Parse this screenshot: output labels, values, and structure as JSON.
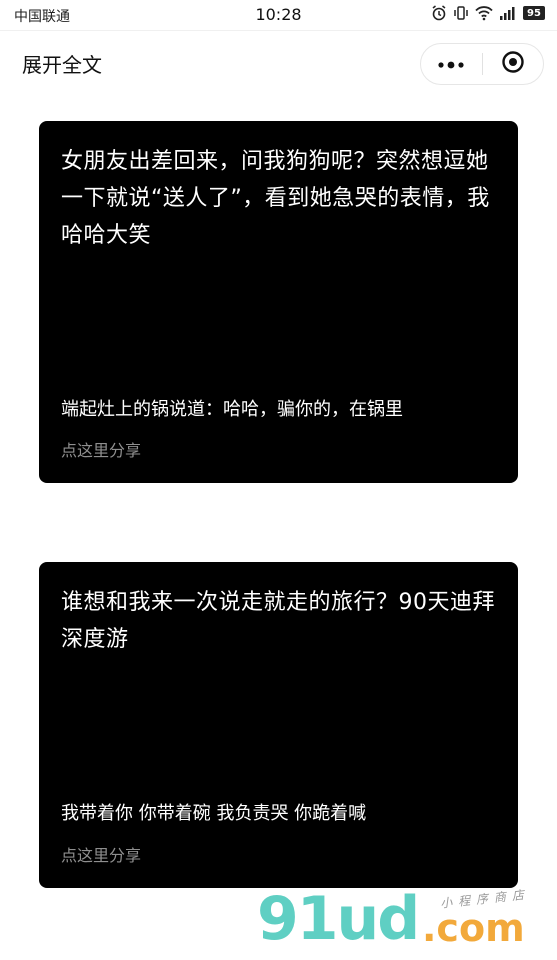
{
  "status_bar": {
    "carrier": "中国联通",
    "time": "10:28",
    "battery_level": "95",
    "icons": [
      "alarm-icon",
      "vibrate-icon",
      "wifi-icon",
      "signal-icon",
      "battery-icon"
    ]
  },
  "nav": {
    "title": "展开全文",
    "menu_icon": "more-dots-icon",
    "close_icon": "target-close-icon"
  },
  "cards": [
    {
      "title": "女朋友出差回来，问我狗狗呢？突然想逗她一下就说“送人了”，看到她急哭的表情，我哈哈大笑",
      "punchline": "端起灶上的锅说道：哈哈，骗你的，在锅里",
      "share": "点这里分享"
    },
    {
      "title": "谁想和我来一次说走就走的旅行？90天迪拜深度游",
      "punchline": "我带着你 你带着碗 我负责哭 你跪着喊",
      "share": "点这里分享"
    }
  ],
  "watermark": {
    "logo": "91ud",
    "domain": ".com",
    "tagline": "小程序商店"
  },
  "colors": {
    "card_bg": "#000000",
    "share_text": "#8f8f8f",
    "wm_teal": "#5fcfc3",
    "wm_orange": "#f2a93b"
  }
}
